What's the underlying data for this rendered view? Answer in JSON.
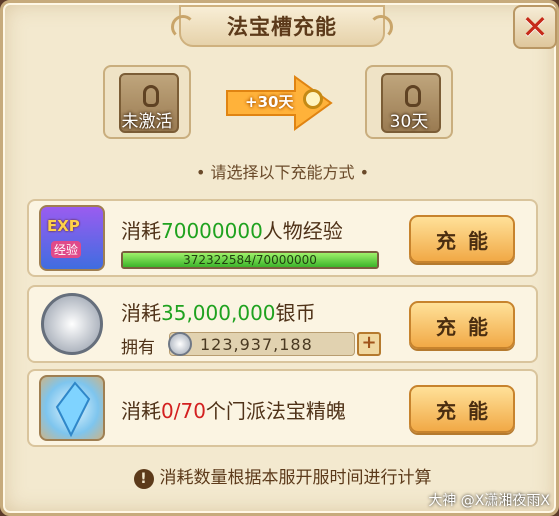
{
  "title": "法宝槽充能",
  "close_label": "✕",
  "slot_before": {
    "label": "未激活"
  },
  "slot_after": {
    "label": "30天"
  },
  "arrow_label": "+30天",
  "hint": "• 请选择以下充能方式 •",
  "options": [
    {
      "prefix": "消耗",
      "amount": "70000000",
      "suffix": "人物经验",
      "button": "充能",
      "progress_text": "372322584/70000000",
      "progress_fraction": 1.0,
      "icon": "exp-potion-icon",
      "icon_text": "EXP",
      "icon_sub": "经验"
    },
    {
      "prefix": "消耗",
      "amount": "35,000,000",
      "suffix": "银币",
      "button": "充能",
      "own_label": "拥有",
      "own_value": "123,937,188",
      "icon": "silver-coin-icon"
    },
    {
      "prefix": "消耗",
      "amount": "0/70",
      "suffix": "个门派法宝精魄",
      "button": "充能",
      "icon": "crystal-soul-icon"
    }
  ],
  "notice": "消耗数量根据本服开服时间进行计算",
  "watermark": "大神 @X潇湘夜雨X",
  "colors": {
    "amount_green": "#1fa21f",
    "amount_red": "#d32020",
    "accent": "#f1a946"
  }
}
